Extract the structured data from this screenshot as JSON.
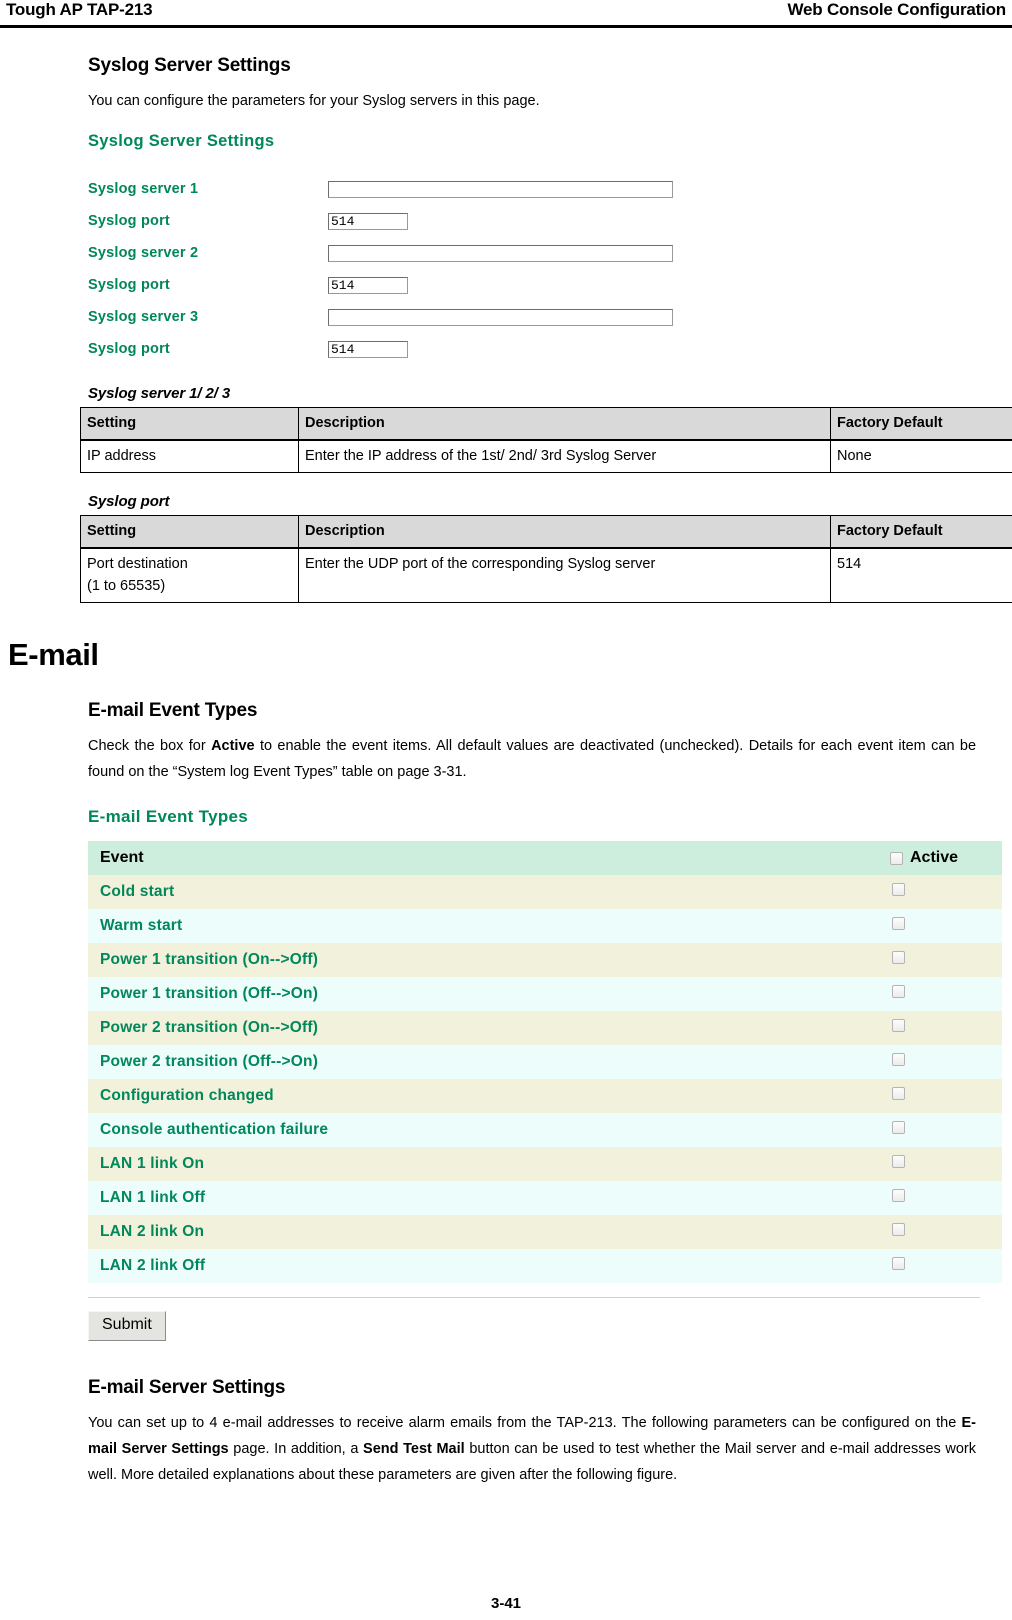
{
  "running_head": {
    "left": "Tough AP TAP-213",
    "right": "Web Console Configuration"
  },
  "syslog": {
    "heading": "Syslog Server Settings",
    "intro": "You can configure the parameters for your Syslog servers in this page.",
    "console": {
      "title": "Syslog Server Settings",
      "fields": [
        {
          "label": "Syslog server 1",
          "value": "",
          "kind": "wide"
        },
        {
          "label": "Syslog port",
          "value": "514",
          "kind": "short"
        },
        {
          "label": "Syslog server 2",
          "value": "",
          "kind": "wide"
        },
        {
          "label": "Syslog port",
          "value": "514",
          "kind": "short"
        },
        {
          "label": "Syslog server 3",
          "value": "",
          "kind": "wide"
        },
        {
          "label": "Syslog port",
          "value": "514",
          "kind": "short"
        }
      ]
    },
    "table_server": {
      "caption": "Syslog server 1/ 2/ 3",
      "headers": [
        "Setting",
        "Description",
        "Factory Default"
      ],
      "rows": [
        {
          "setting": "IP address",
          "description": "Enter the IP address of the 1st/ 2nd/ 3rd Syslog Server",
          "default": "None"
        }
      ]
    },
    "table_port": {
      "caption": "Syslog port",
      "headers": [
        "Setting",
        "Description",
        "Factory Default"
      ],
      "rows": [
        {
          "setting": "Port destination",
          "setting_line2": "(1 to 65535)",
          "description": "Enter the UDP port of the corresponding Syslog server",
          "default": "514"
        }
      ]
    }
  },
  "email": {
    "chapter_heading": "E-mail",
    "event_types": {
      "heading": "E-mail Event Types",
      "intro_1": "Check the box for ",
      "intro_bold": "Active",
      "intro_2": " to enable the event items. All default values are deactivated (unchecked). Details for each event item can be found on the “System log Event Types” table on page 3-31.",
      "console": {
        "title": "E-mail Event Types",
        "header_event": "Event",
        "header_active": "Active",
        "rows": [
          {
            "label": "Cold start",
            "checked": false
          },
          {
            "label": "Warm start",
            "checked": false
          },
          {
            "label": "Power 1 transition (On-->Off)",
            "checked": false
          },
          {
            "label": "Power 1 transition (Off-->On)",
            "checked": false
          },
          {
            "label": "Power 2 transition (On-->Off)",
            "checked": false
          },
          {
            "label": "Power 2 transition (Off-->On)",
            "checked": false
          },
          {
            "label": "Configuration changed",
            "checked": false
          },
          {
            "label": "Console authentication failure",
            "checked": false
          },
          {
            "label": "LAN 1 link On",
            "checked": false
          },
          {
            "label": "LAN 1 link Off",
            "checked": false
          },
          {
            "label": "LAN 2 link On",
            "checked": false
          },
          {
            "label": "LAN 2 link Off",
            "checked": false
          }
        ],
        "submit_label": "Submit"
      }
    },
    "server_settings": {
      "heading": "E-mail Server Settings",
      "para_1": "You can set up to 4 e-mail addresses to receive alarm emails from the TAP-213. The following parameters can be configured on the ",
      "para_bold_1": "E-mail Server Settings",
      "para_2": " page. In addition, a ",
      "para_bold_2": "Send Test Mail",
      "para_3": " button can be used to test whether the Mail server and e-mail addresses work well. More detailed explanations about these parameters are given after the following figure."
    }
  },
  "footer": {
    "page_number": "3-41"
  },
  "colors": {
    "console_green": "#00875a",
    "table_header_gray": "#d9d9d9",
    "evt_header_mint": "#cdeedd",
    "evt_row_cream": "#f2f1dc",
    "evt_row_cyan": "#ecfdfb"
  }
}
